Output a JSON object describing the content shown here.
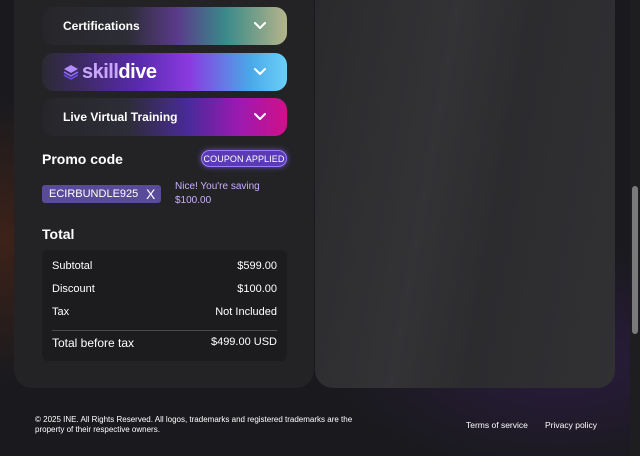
{
  "accordions": {
    "certifications": {
      "label": "Certifications",
      "icon": "chevron-down-icon"
    },
    "skilldive": {
      "logo_word1": "skill",
      "logo_word2": "dive",
      "icon": "chevron-down-icon"
    },
    "live_training": {
      "label": "Live Virtual Training",
      "icon": "chevron-down-icon"
    }
  },
  "promo": {
    "title": "Promo code",
    "badge": "COUPON APPLIED",
    "code": "ECIRBUNDLE925",
    "remove_label": "X",
    "saving_text": "Nice! You're saving $100.00"
  },
  "total": {
    "title": "Total",
    "rows": {
      "subtotal": {
        "label": "Subtotal",
        "value": "$599.00"
      },
      "discount": {
        "label": "Discount",
        "value": "$100.00"
      },
      "tax": {
        "label": "Tax",
        "value": "Not Included"
      },
      "total_before_tax": {
        "label": "Total before tax",
        "value": "$499.00 USD"
      }
    }
  },
  "footer": {
    "copyright": "© 2025 INE. All Rights Reserved. All logos, trademarks and registered trademarks are the property of their respective owners.",
    "terms": "Terms of service",
    "privacy": "Privacy policy"
  },
  "colors": {
    "accent_purple": "#5b3ab8",
    "saving_text": "#c8b0ff",
    "background": "#1a1a1e"
  }
}
